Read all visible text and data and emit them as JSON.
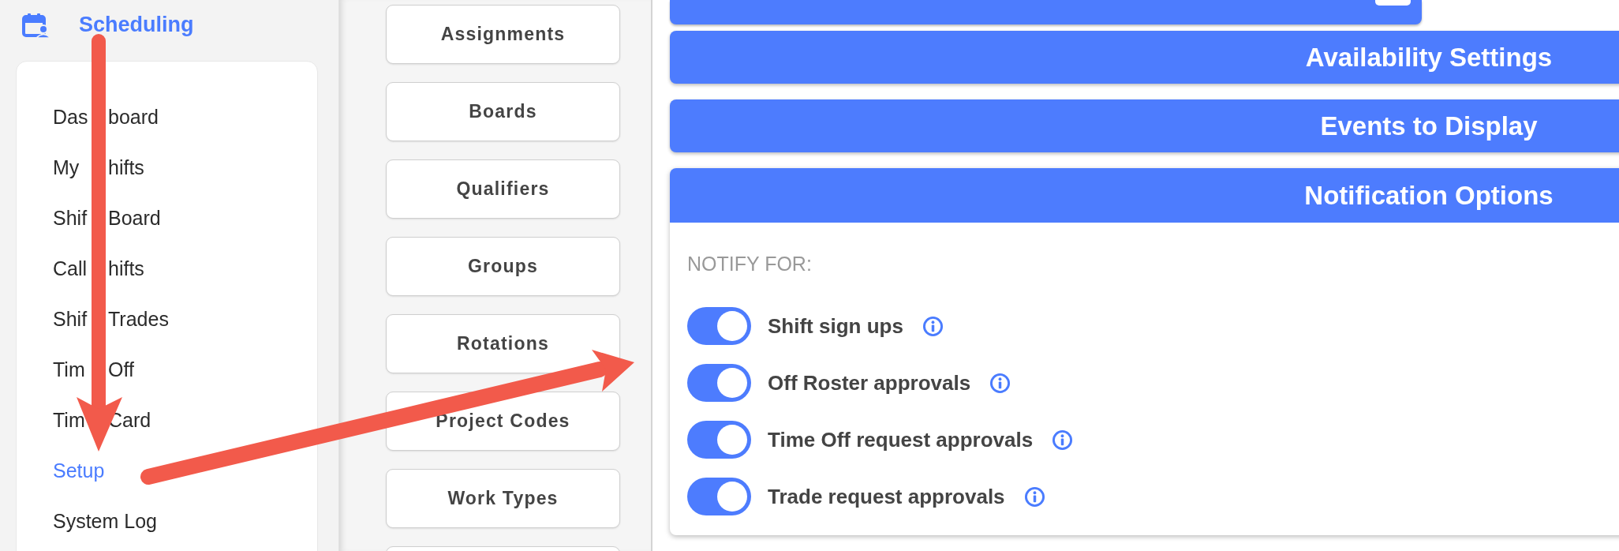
{
  "sidebar": {
    "title": "Scheduling",
    "items": [
      {
        "parts": [
          "Das",
          "board"
        ],
        "selected": false
      },
      {
        "parts": [
          "My",
          "hifts"
        ],
        "selected": false
      },
      {
        "parts": [
          "Shif",
          "Board"
        ],
        "selected": false
      },
      {
        "parts": [
          "Call",
          "hifts"
        ],
        "selected": false
      },
      {
        "parts": [
          "Shif",
          "Trades"
        ],
        "selected": false
      },
      {
        "parts": [
          "Tim",
          "Off"
        ],
        "selected": false
      },
      {
        "parts": [
          "Tim",
          "Card"
        ],
        "selected": false
      },
      {
        "label": "Setup",
        "selected": true
      },
      {
        "label": "System Log",
        "selected": false
      }
    ]
  },
  "setup_menu": {
    "buttons": [
      "Assignments",
      "Boards",
      "Qualifiers",
      "Groups",
      "Rotations",
      "Project Codes",
      "Work Types"
    ]
  },
  "sections": [
    {
      "title": "Availability Settings",
      "expanded": false
    },
    {
      "title": "Events to Display",
      "expanded": false
    },
    {
      "title": "Notification Options",
      "expanded": true,
      "heading": "NOTIFY FOR:",
      "options": [
        {
          "label": "Shift sign ups",
          "on": true
        },
        {
          "label": "Off Roster approvals",
          "on": true
        },
        {
          "label": "Time Off request approvals",
          "on": true
        },
        {
          "label": "Trade request approvals",
          "on": true
        }
      ]
    }
  ]
}
